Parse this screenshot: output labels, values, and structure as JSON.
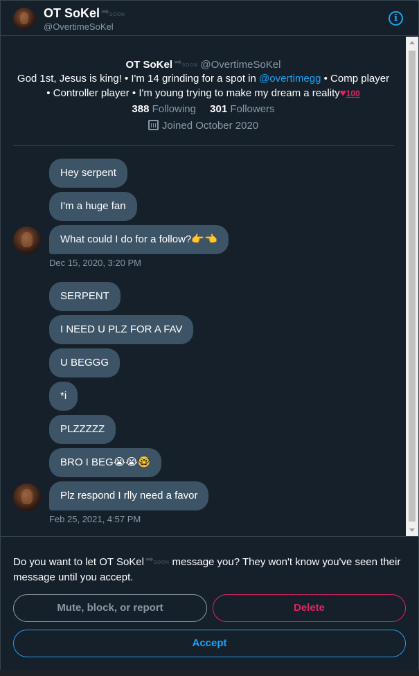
{
  "header": {
    "name": "OT SoKel",
    "badge": "SOON",
    "handle": "@OvertimeSoKel",
    "info_icon": "info-icon"
  },
  "profile": {
    "name": "OT SoKel",
    "badge": "SOON",
    "handle": "@OvertimeSoKel",
    "bio_part1": "God 1st, Jesus is king! • I'm 14 grinding for a spot in ",
    "bio_mention": "@overtimegg",
    "bio_part2": " • Comp player • Controller player • I'm young trying to make my dream a reality",
    "following_count": "388",
    "following_label": "Following",
    "followers_count": "301",
    "followers_label": "Followers",
    "joined": "Joined October 2020"
  },
  "messages": {
    "group1": [
      "Hey serpent",
      "I'm a huge fan",
      "What could I do for a follow?👉👈"
    ],
    "group1_time": "Dec 15, 2020, 3:20 PM",
    "group2": [
      "SERPENT",
      "I NEED U PLZ FOR A FAV",
      "U BEGGG",
      "*i",
      "PLZZZZZ",
      "BRO I BEG😭😭🤓",
      "Plz respond I rlly need a favor"
    ],
    "group2_time": "Feb 25, 2021, 4:57 PM"
  },
  "request": {
    "text_part1": "Do you want to let OT SoKel",
    "text_part2": " message you? They won't know you've seen their message until you accept.",
    "mute_label": "Mute, block, or report",
    "delete_label": "Delete",
    "accept_label": "Accept"
  },
  "colors": {
    "background": "#15202b",
    "bubble": "#3d5466",
    "accent": "#1da1f2",
    "danger": "#e0245e",
    "muted": "#8899a6"
  }
}
